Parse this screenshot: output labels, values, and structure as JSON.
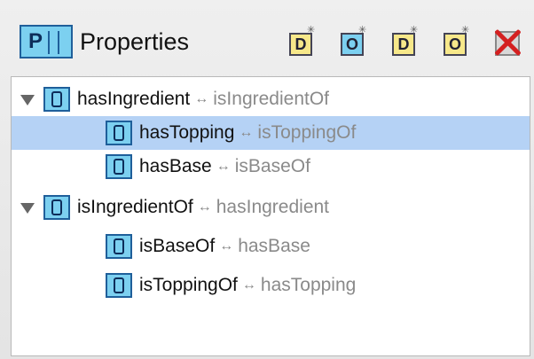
{
  "header": {
    "badge_letter": "P",
    "title": "Properties",
    "tools": [
      {
        "name": "add-datatype-property",
        "letter": "D",
        "icon": "datatype-property-icon"
      },
      {
        "name": "add-object-property",
        "letter": "O",
        "icon": "object-property-icon"
      },
      {
        "name": "add-sub-datatype-property",
        "letter": "D",
        "icon": "datatype-property-icon"
      },
      {
        "name": "add-sub-object-property",
        "letter": "O",
        "icon": "object-property-icon"
      },
      {
        "name": "delete-property",
        "icon": "delete-icon"
      }
    ]
  },
  "tree": {
    "arrow_symbol": "↔",
    "rows": [
      {
        "name": "hasIngredient",
        "inverse": "isIngredientOf",
        "expanded": true,
        "level": 0
      },
      {
        "name": "hasTopping",
        "inverse": "isToppingOf",
        "selected": true,
        "level": 1
      },
      {
        "name": "hasBase",
        "inverse": "isBaseOf",
        "level": 1
      },
      {
        "name": "isIngredientOf",
        "inverse": "hasIngredient",
        "expanded": true,
        "level": 0
      },
      {
        "name": "isBaseOf",
        "inverse": "hasBase",
        "level": 1
      },
      {
        "name": "isToppingOf",
        "inverse": "hasTopping",
        "level": 1
      }
    ]
  },
  "colors": {
    "selection": "#b5d2f5",
    "icon_fill": "#7cd0f0",
    "icon_border": "#1f5f9a",
    "inverse_text": "#8a8a8a",
    "delete_red": "#d42020"
  }
}
